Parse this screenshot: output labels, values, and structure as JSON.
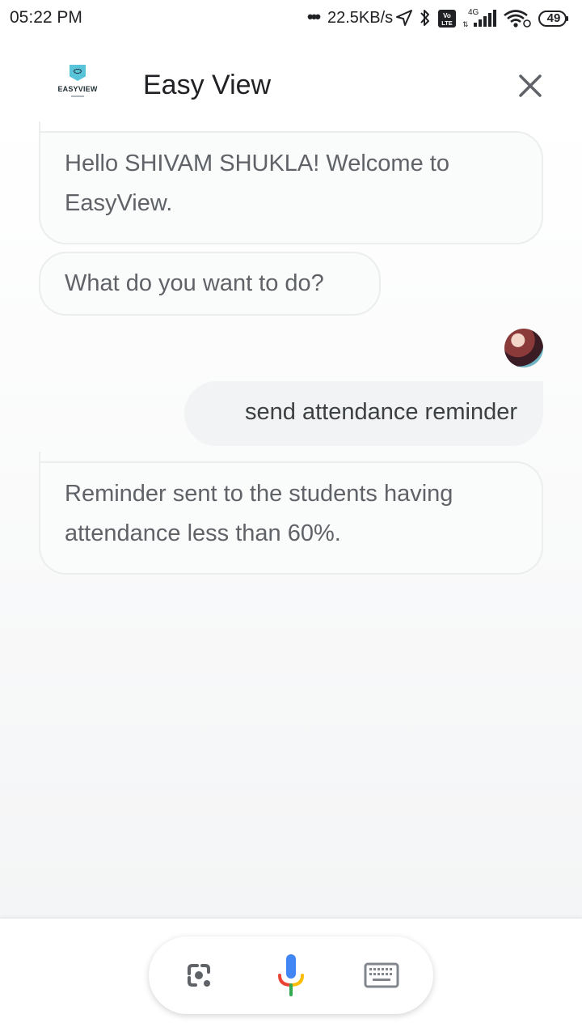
{
  "status_bar": {
    "time": "05:22 PM",
    "network_speed": "22.5KB/s",
    "network_type": "4G",
    "volte_label_top": "Vo",
    "volte_label_bottom": "LTE",
    "battery_level": "49",
    "icons": [
      "more-dots-icon",
      "location-arrow-icon",
      "bluetooth-icon",
      "volte-icon",
      "signal-bars-icon",
      "wifi-icon",
      "battery-icon"
    ]
  },
  "header": {
    "logo_text": "EASYVIEW",
    "title": "Easy View",
    "close_icon": "close-icon"
  },
  "chat": {
    "messages": [
      {
        "sender": "bot",
        "text": "Hello SHIVAM SHUKLA! Welcome to EasyView."
      },
      {
        "sender": "bot",
        "text": "What do you want to do?"
      },
      {
        "sender": "user",
        "text": "send attendance reminder"
      },
      {
        "sender": "bot",
        "text": "Reminder sent to the students having attendance less than 60%."
      }
    ]
  },
  "input_bar": {
    "buttons": [
      "lens-icon",
      "microphone-icon",
      "keyboard-icon"
    ]
  },
  "colors": {
    "mic_blue": "#4285f4",
    "mic_red": "#ea4335",
    "mic_yellow": "#fbbc04",
    "mic_green": "#34a853",
    "logo_accent": "#59c3d9"
  }
}
